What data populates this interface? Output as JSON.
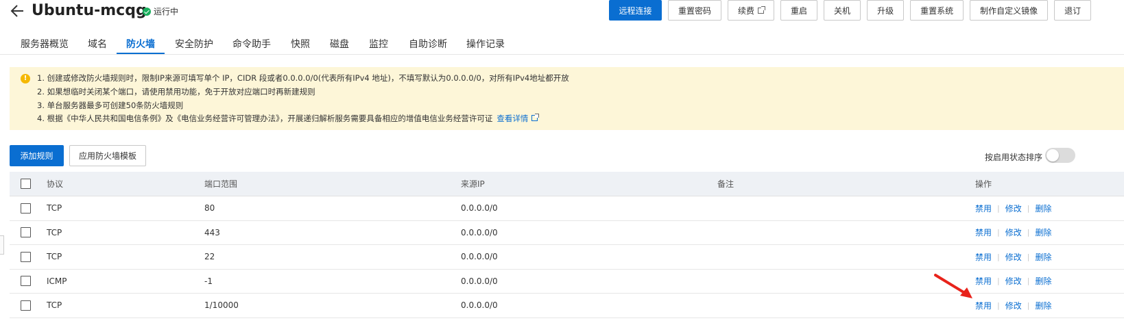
{
  "header": {
    "server_name": "Ubuntu-mcqg",
    "status": "运行中",
    "status_color": "#1aaf5d",
    "actions": [
      {
        "label": "远程连接",
        "primary": true
      },
      {
        "label": "重置密码"
      },
      {
        "label": "续费",
        "external": true
      },
      {
        "label": "重启"
      },
      {
        "label": "关机"
      },
      {
        "label": "升级"
      },
      {
        "label": "重置系统"
      },
      {
        "label": "制作自定义镜像"
      },
      {
        "label": "退订"
      }
    ]
  },
  "tabs": [
    "服务器概览",
    "域名",
    "防火墙",
    "安全防护",
    "命令助手",
    "快照",
    "磁盘",
    "监控",
    "自助诊断",
    "操作记录"
  ],
  "active_tab": "防火墙",
  "notice": {
    "lines": [
      "1. 创建或修改防火墙规则时，限制IP来源可填写单个 IP，CIDR 段或者0.0.0.0/0(代表所有IPv4 地址)，不填写默认为0.0.0.0/0，对所有IPv4地址都开放",
      "2. 如果想临时关闭某个端口，请使用禁用功能，免于开放对应端口时再新建规则",
      "3. 单台服务器最多可创建50条防火墙规则",
      "4. 根据《中华人民共和国电信条例》及《电信业务经营许可管理办法》，开展递归解析服务需要具备相应的增值电信业务经营许可证"
    ],
    "link": "查看详情"
  },
  "toolbar": {
    "add_rule": "添加规则",
    "apply_template": "应用防火墙模板",
    "sort_label": "按启用状态排序"
  },
  "table": {
    "headers": {
      "protocol": "协议",
      "port": "端口范围",
      "source": "来源IP",
      "remark": "备注",
      "ops": "操作"
    },
    "rows": [
      {
        "protocol": "TCP",
        "port": "80",
        "source": "0.0.0.0/0",
        "remark": ""
      },
      {
        "protocol": "TCP",
        "port": "443",
        "source": "0.0.0.0/0",
        "remark": ""
      },
      {
        "protocol": "TCP",
        "port": "22",
        "source": "0.0.0.0/0",
        "remark": ""
      },
      {
        "protocol": "ICMP",
        "port": "-1",
        "source": "0.0.0.0/0",
        "remark": ""
      },
      {
        "protocol": "TCP",
        "port": "1/10000",
        "source": "0.0.0.0/0",
        "remark": ""
      }
    ],
    "ops": {
      "disable": "禁用",
      "edit": "修改",
      "delete": "删除"
    }
  },
  "colors": {
    "accent": "#0a6ed1",
    "notice_bg": "#fdf6d8",
    "arrow": "#e8231b"
  }
}
